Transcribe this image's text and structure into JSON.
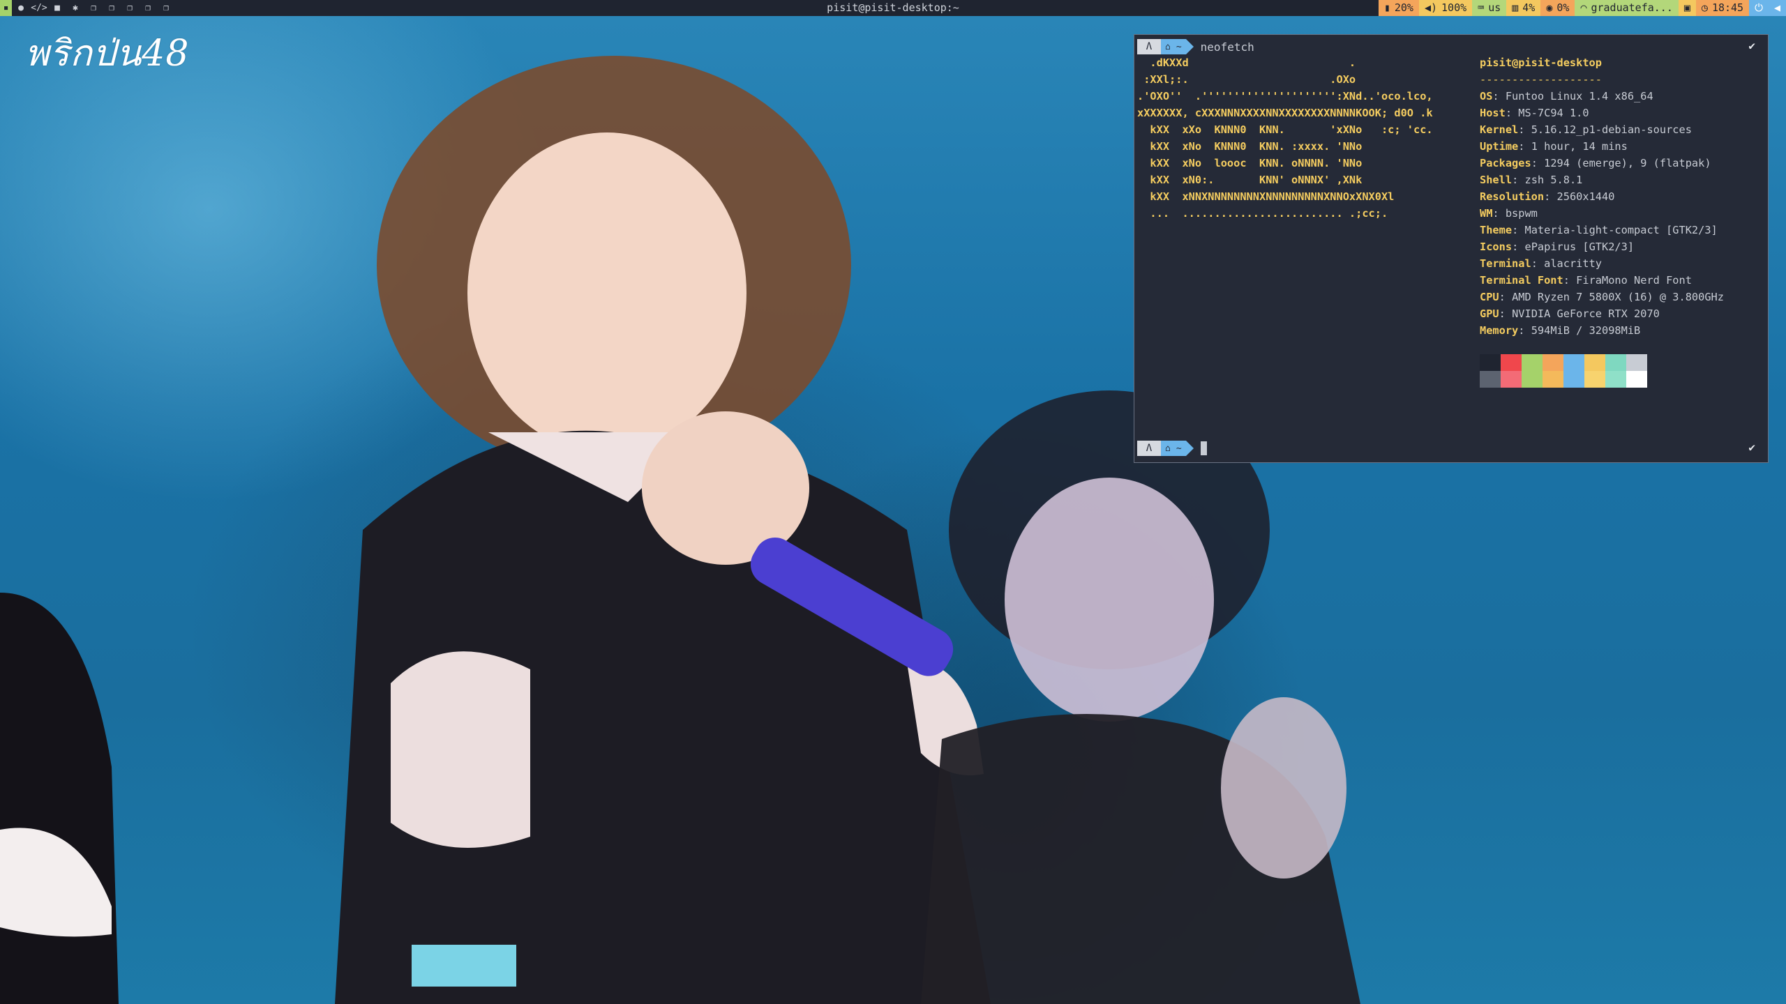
{
  "topbar": {
    "workspaces": [
      {
        "icon": "terminal-square-icon",
        "glyph": "▪",
        "active": true
      },
      {
        "icon": "firefox-icon",
        "glyph": "●",
        "active": false
      },
      {
        "icon": "code-icon",
        "glyph": "</>",
        "active": false
      },
      {
        "icon": "media-icon",
        "glyph": "■",
        "active": false
      },
      {
        "icon": "settings-icon",
        "glyph": "✱",
        "active": false
      },
      {
        "icon": "window-icon",
        "glyph": "❐",
        "active": false
      },
      {
        "icon": "window-icon",
        "glyph": "❐",
        "active": false
      },
      {
        "icon": "window-icon",
        "glyph": "❐",
        "active": false
      },
      {
        "icon": "window-icon",
        "glyph": "❐",
        "active": false
      },
      {
        "icon": "window-icon",
        "glyph": "❐",
        "active": false
      }
    ],
    "window_title": "pisit@pisit-desktop:~",
    "status": [
      {
        "name": "brightness",
        "icon": "▮",
        "text": "20%",
        "bg": "#f4a55b",
        "fg": "#1f2430"
      },
      {
        "name": "volume",
        "icon": "◀)",
        "text": "100%",
        "bg": "#f4c85f",
        "fg": "#1f2430"
      },
      {
        "name": "keyboard",
        "icon": "⌨",
        "text": "us",
        "bg": "#b3d77a",
        "fg": "#1f2430"
      },
      {
        "name": "memory",
        "icon": "▥",
        "text": "4%",
        "bg": "#f4c85f",
        "fg": "#1f2430"
      },
      {
        "name": "cpu",
        "icon": "◉",
        "text": "0%",
        "bg": "#f4a55b",
        "fg": "#1f2430"
      },
      {
        "name": "wifi",
        "icon": "◠",
        "text": "graduatefa...",
        "bg": "#b3d77a",
        "fg": "#1f2430"
      },
      {
        "name": "layout",
        "icon": "▣",
        "text": "",
        "bg": "#f4c85f",
        "fg": "#1f2430"
      },
      {
        "name": "clock",
        "icon": "◷",
        "text": "18:45",
        "bg": "#f4a55b",
        "fg": "#1f2430"
      },
      {
        "name": "power",
        "icon": "⏻",
        "text": "",
        "bg": "#6bb5ea",
        "fg": "#ffffff"
      },
      {
        "name": "sound",
        "icon": "◀",
        "text": "",
        "bg": "#6bb5ea",
        "fg": "#ffffff"
      }
    ]
  },
  "wallpaper": {
    "logo_text": "พริกป่น48"
  },
  "terminal": {
    "prompt1": {
      "os_icon": "Λ",
      "home_icon": "⌂",
      "dir": "~",
      "command": "neofetch",
      "status": "✔"
    },
    "prompt2": {
      "os_icon": "Λ",
      "home_icon": "⌂",
      "dir": "~",
      "status": "✔"
    },
    "ascii_art": [
      "  .dKXXd                         .",
      " :XXl;:.                      .OXo",
      ".'OXO''  .''''''''''''''''''''':XNd..'oco.lco,",
      "xXXXXXX, cXXXNNNXXXXNNXXXXXXXXNNNNKOOK; d0O .k",
      "  kXX  xXo  KNNN0  KNN.       'xXNo   :c; 'cc.",
      "  kXX  xNo  KNNN0  KNN. :xxxx. 'NNo",
      "  kXX  xNo  loooc  KNN. oNNNN. 'NNo",
      "  kXX  xN0:.       KNN' oNNNX' ,XNk",
      "  kXX  xNNXNNNNNNNNXNNNNNNNNNXNNOxXNX0Xl",
      "  ...  ......................... .;cc;."
    ],
    "userhost": "pisit@pisit-desktop",
    "separator": "-------------------",
    "info": [
      {
        "key": "OS",
        "value": "Funtoo Linux 1.4 x86_64"
      },
      {
        "key": "Host",
        "value": "MS-7C94 1.0"
      },
      {
        "key": "Kernel",
        "value": "5.16.12_p1-debian-sources"
      },
      {
        "key": "Uptime",
        "value": "1 hour, 14 mins"
      },
      {
        "key": "Packages",
        "value": "1294 (emerge), 9 (flatpak)"
      },
      {
        "key": "Shell",
        "value": "zsh 5.8.1"
      },
      {
        "key": "Resolution",
        "value": "2560x1440"
      },
      {
        "key": "WM",
        "value": "bspwm"
      },
      {
        "key": "Theme",
        "value": "Materia-light-compact [GTK2/3]"
      },
      {
        "key": "Icons",
        "value": "ePapirus [GTK2/3]"
      },
      {
        "key": "Terminal",
        "value": "alacritty"
      },
      {
        "key": "Terminal Font",
        "value": "FiraMono Nerd Font"
      },
      {
        "key": "CPU",
        "value": "AMD Ryzen 7 5800X (16) @ 3.800GHz"
      },
      {
        "key": "GPU",
        "value": "NVIDIA GeForce RTX 2070"
      },
      {
        "key": "Memory",
        "value": "594MiB / 32098MiB"
      }
    ],
    "palette": [
      [
        "#1f2430",
        "#f0474c",
        "#a5d26a",
        "#f4a55b",
        "#6bb5ea",
        "#f4c85f",
        "#7fd8c0",
        "#c8ccd4"
      ],
      [
        "#5c6370",
        "#f36b76",
        "#a5d26a",
        "#f4b95b",
        "#6bb5ea",
        "#f7d36e",
        "#8fe0c8",
        "#ffffff"
      ]
    ]
  }
}
